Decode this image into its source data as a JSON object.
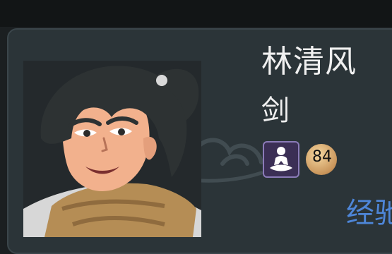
{
  "character": {
    "name": "林清风",
    "role": "剑",
    "level": "84",
    "skill_icon": "meditation-icon"
  },
  "footer": {
    "exp_label_partial": "经驰"
  },
  "colors": {
    "panel": "#2b3438",
    "exp_text": "#4e86d8"
  }
}
